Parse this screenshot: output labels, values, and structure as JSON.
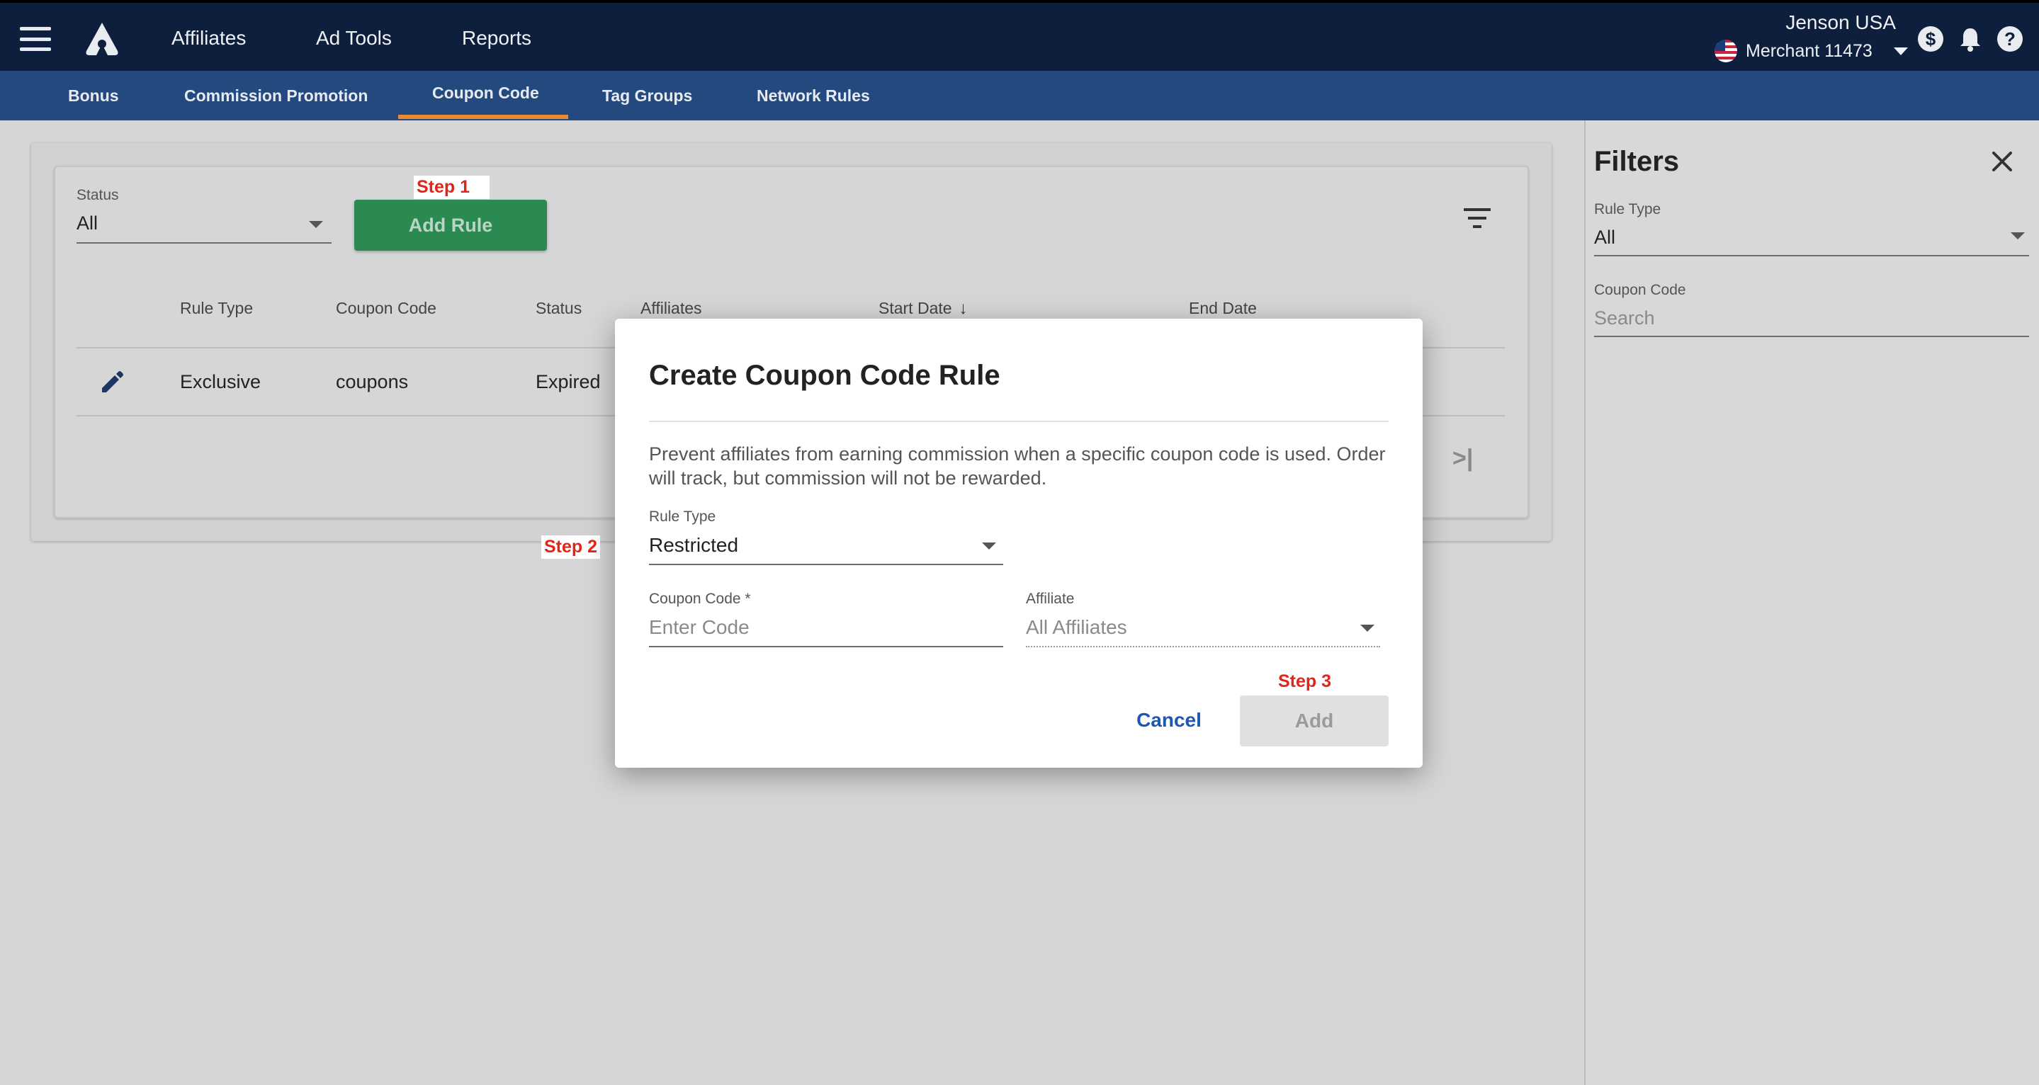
{
  "topbar": {
    "nav": [
      "Affiliates",
      "Ad Tools",
      "Reports"
    ],
    "brand_name": "Jenson USA",
    "merchant": "Merchant 11473"
  },
  "subnav": {
    "tabs": [
      "Bonus",
      "Commission Promotion",
      "Coupon Code",
      "Tag Groups",
      "Network Rules"
    ],
    "active_tab": "Coupon Code"
  },
  "toolbar": {
    "status_label": "Status",
    "status_value": "All",
    "add_rule_label": "Add Rule"
  },
  "steps": {
    "step1": "Step 1",
    "step2": "Step 2",
    "step3": "Step 3"
  },
  "table": {
    "headers": [
      "Rule Type",
      "Coupon Code",
      "Status",
      "Affiliates",
      "Start Date",
      "End Date"
    ],
    "rows": [
      {
        "rule_type": "Exclusive",
        "coupon_code": "coupons",
        "status": "Expired"
      }
    ]
  },
  "filters": {
    "title": "Filters",
    "rule_type_label": "Rule Type",
    "rule_type_value": "All",
    "coupon_code_label": "Coupon Code",
    "coupon_code_placeholder": "Search"
  },
  "modal": {
    "title": "Create Coupon Code Rule",
    "description": "Prevent affiliates from earning commission when a specific coupon code is used. Order will track, but commission will not be rewarded.",
    "rule_type_label": "Rule Type",
    "rule_type_value": "Restricted",
    "coupon_code_label": "Coupon Code *",
    "coupon_code_placeholder": "Enter Code",
    "affiliate_label": "Affiliate",
    "affiliate_value": "All Affiliates",
    "cancel_label": "Cancel",
    "add_label": "Add"
  },
  "colors": {
    "topbar": "#0d1f3c",
    "subnav": "#23497f",
    "active_tab_underline": "#ec8a2c",
    "primary_button": "#2a8a52",
    "step_label": "#e0261a",
    "link": "#1d57b2"
  }
}
